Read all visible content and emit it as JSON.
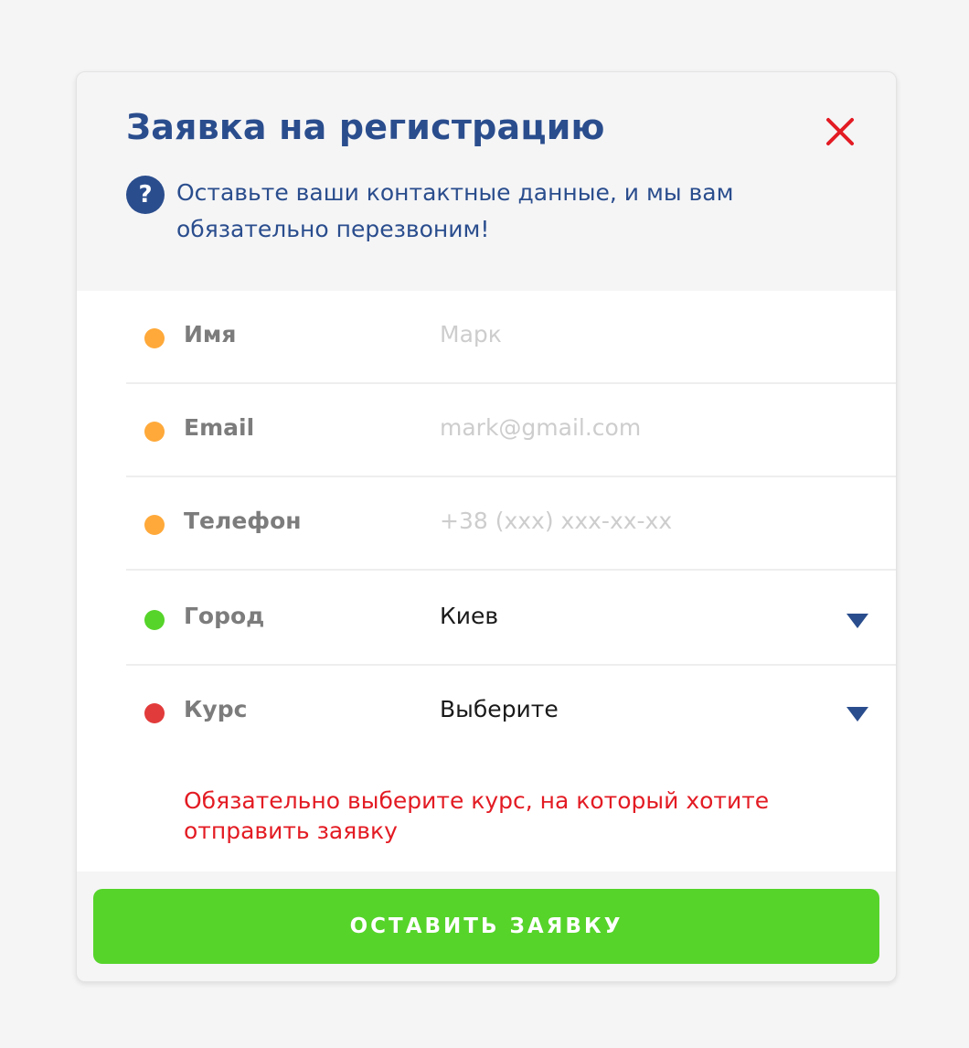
{
  "modal": {
    "title": "Заявка на регистрацию",
    "close_icon": "close-icon",
    "help_icon": "question-icon",
    "help_glyph": "?",
    "subtitle": "Оставьте ваши контактные данные, и мы вам обязательно перезвоним!"
  },
  "fields": [
    {
      "label": "Имя",
      "placeholder": "Марк",
      "value": "",
      "status": "warning",
      "status_color": "#ffa93a"
    },
    {
      "label": "Email",
      "placeholder": "mark@gmail.com",
      "value": "",
      "status": "warning",
      "status_color": "#ffa93a"
    },
    {
      "label": "Телефон",
      "placeholder": "+38 (xxx) xxx-xx-xx",
      "value": "",
      "status": "warning",
      "status_color": "#ffa93a"
    },
    {
      "label": "Город",
      "value": "Киев",
      "status": "valid",
      "status_color": "#56d42a",
      "icon": "chevron-down-icon"
    },
    {
      "label": "Курс",
      "value": "Выберите",
      "status": "error",
      "status_color": "#e23b3b",
      "icon": "chevron-down-icon"
    }
  ],
  "error_message": "Обязательно выберите курс, на который хотите отправить заявку",
  "submit": {
    "label": "ОСТАВИТЬ ЗАЯВКУ"
  },
  "colors": {
    "title": "#2a4d8d",
    "close": "#e31b23",
    "error": "#e31b23",
    "button": "#56d42a",
    "background": "#f5f5f5"
  }
}
